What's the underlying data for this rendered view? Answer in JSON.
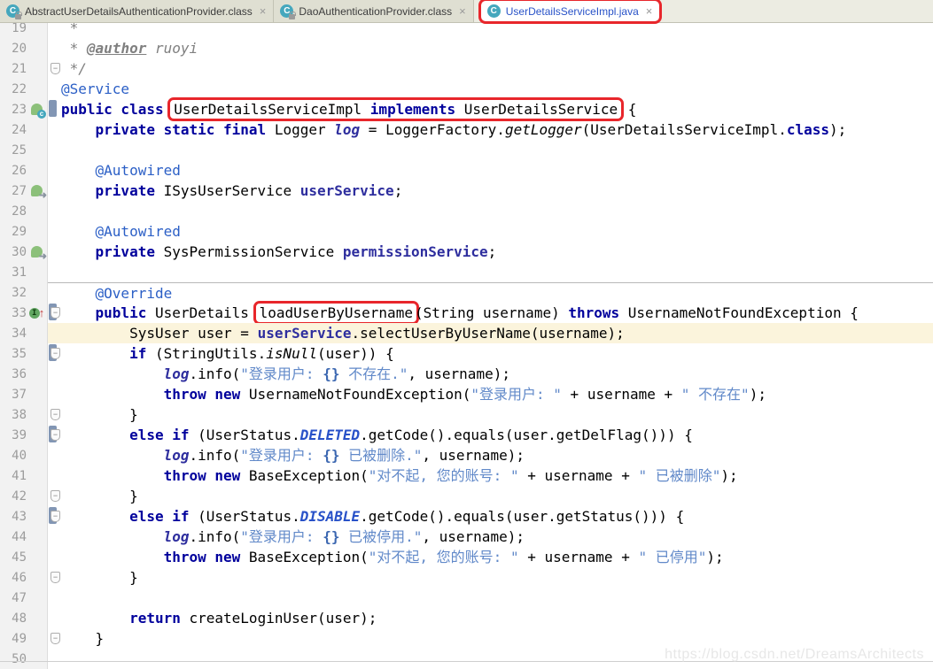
{
  "colors": {
    "annotation_red": "#E8262B",
    "active_tab_text": "#2953C8",
    "keyword_navy": "#00009C",
    "string_blue": "#6189C9",
    "caret_line_bg": "#FBF4DC",
    "gutter_bg": "#F2F2F2",
    "vcs_change_bar": "#8296B4"
  },
  "tabs": [
    {
      "label": "AbstractUserDetailsAuthenticationProvider.class",
      "icon": "class-file-icon",
      "active": false
    },
    {
      "label": "DaoAuthenticationProvider.class",
      "icon": "class-file-icon",
      "active": false
    },
    {
      "label": "UserDetailsServiceImpl.java",
      "icon": "java-class-icon",
      "active": true,
      "annotated": true
    }
  ],
  "watermark": "https://blog.csdn.net/DreamsArchitects",
  "editor": {
    "first_line": 19,
    "caret_line": 34,
    "lines": [
      {
        "n": 19,
        "tokens": [
          [
            "cmt",
            " *"
          ]
        ]
      },
      {
        "n": 20,
        "tokens": [
          [
            "cmt",
            " * "
          ],
          [
            "cmtTag",
            "@author"
          ],
          [
            "cmt",
            " ruoyi"
          ]
        ]
      },
      {
        "n": 21,
        "fold": true,
        "tokens": [
          [
            "cmt",
            " */"
          ]
        ]
      },
      {
        "n": 22,
        "tokens": [
          [
            "ann",
            "@Service"
          ]
        ]
      },
      {
        "n": 23,
        "icon": "spring-bean",
        "vcs": true,
        "tokens": [
          [
            "kw",
            "public class "
          ],
          [
            "box",
            [
              [
                "plain",
                "UserDetailsServiceImpl "
              ],
              [
                "kw",
                "implements"
              ],
              [
                "plain",
                " UserDetailsService"
              ]
            ]
          ],
          [
            "plain",
            " {"
          ]
        ]
      },
      {
        "n": 24,
        "tokens": [
          [
            "plain",
            "    "
          ],
          [
            "kw",
            "private static final "
          ],
          [
            "plain",
            "Logger "
          ],
          [
            "sfield",
            "log"
          ],
          [
            "plain",
            " = LoggerFactory."
          ],
          [
            "smeth",
            "getLogger"
          ],
          [
            "plain",
            "(UserDetailsServiceImpl."
          ],
          [
            "kw",
            "class"
          ],
          [
            "plain",
            ");"
          ]
        ]
      },
      {
        "n": 25,
        "tokens": []
      },
      {
        "n": 26,
        "tokens": [
          [
            "plain",
            "    "
          ],
          [
            "ann",
            "@Autowired"
          ]
        ]
      },
      {
        "n": 27,
        "icon": "spring-autowired",
        "tokens": [
          [
            "plain",
            "    "
          ],
          [
            "kw",
            "private "
          ],
          [
            "plain",
            "ISysUserService "
          ],
          [
            "field",
            "userService"
          ],
          [
            "plain",
            ";"
          ]
        ]
      },
      {
        "n": 28,
        "tokens": []
      },
      {
        "n": 29,
        "tokens": [
          [
            "plain",
            "    "
          ],
          [
            "ann",
            "@Autowired"
          ]
        ]
      },
      {
        "n": 30,
        "icon": "spring-autowired",
        "tokens": [
          [
            "plain",
            "    "
          ],
          [
            "kw",
            "private "
          ],
          [
            "plain",
            "SysPermissionService "
          ],
          [
            "field",
            "permissionService"
          ],
          [
            "plain",
            ";"
          ]
        ]
      },
      {
        "n": 31,
        "tokens": []
      },
      {
        "n": 32,
        "sep": true,
        "tokens": [
          [
            "plain",
            "    "
          ],
          [
            "ann",
            "@Override"
          ]
        ]
      },
      {
        "n": 33,
        "icon": "override-method",
        "vcs": true,
        "fold": true,
        "tokens": [
          [
            "plain",
            "    "
          ],
          [
            "kw",
            "public "
          ],
          [
            "plain",
            "UserDetails "
          ],
          [
            "box",
            [
              [
                "plain",
                "loadUserByUsername"
              ]
            ]
          ],
          [
            "plain",
            "(String username) "
          ],
          [
            "kw",
            "throws"
          ],
          [
            "plain",
            " UsernameNotFoundException {"
          ]
        ]
      },
      {
        "n": 34,
        "hl": true,
        "tokens": [
          [
            "plain",
            "        SysUser user = "
          ],
          [
            "field",
            "userService"
          ],
          [
            "plain",
            ".selectUserByUserName(username);"
          ]
        ]
      },
      {
        "n": 35,
        "vcs": true,
        "fold": true,
        "tokens": [
          [
            "plain",
            "        "
          ],
          [
            "kw",
            "if "
          ],
          [
            "plain",
            "(StringUtils."
          ],
          [
            "smeth",
            "isNull"
          ],
          [
            "plain",
            "(user)) {"
          ]
        ]
      },
      {
        "n": 36,
        "tokens": [
          [
            "plain",
            "            "
          ],
          [
            "sfield",
            "log"
          ],
          [
            "plain",
            ".info("
          ],
          [
            "str",
            "\"登录用户: "
          ],
          [
            "strTpl",
            "{}"
          ],
          [
            "str",
            " 不存在.\""
          ],
          [
            "plain",
            ", username);"
          ]
        ]
      },
      {
        "n": 37,
        "tokens": [
          [
            "plain",
            "            "
          ],
          [
            "kw",
            "throw new "
          ],
          [
            "plain",
            "UsernameNotFoundException("
          ],
          [
            "str",
            "\"登录用户: \""
          ],
          [
            "plain",
            " + username + "
          ],
          [
            "str",
            "\" 不存在\""
          ],
          [
            "plain",
            ");"
          ]
        ]
      },
      {
        "n": 38,
        "fold": true,
        "tokens": [
          [
            "plain",
            "        }"
          ]
        ]
      },
      {
        "n": 39,
        "vcs": true,
        "fold": true,
        "tokens": [
          [
            "plain",
            "        "
          ],
          [
            "kw",
            "else if "
          ],
          [
            "plain",
            "(UserStatus."
          ],
          [
            "const",
            "DELETED"
          ],
          [
            "plain",
            ".getCode().equals(user.getDelFlag())) {"
          ]
        ]
      },
      {
        "n": 40,
        "tokens": [
          [
            "plain",
            "            "
          ],
          [
            "sfield",
            "log"
          ],
          [
            "plain",
            ".info("
          ],
          [
            "str",
            "\"登录用户: "
          ],
          [
            "strTpl",
            "{}"
          ],
          [
            "str",
            " 已被删除.\""
          ],
          [
            "plain",
            ", username);"
          ]
        ]
      },
      {
        "n": 41,
        "tokens": [
          [
            "plain",
            "            "
          ],
          [
            "kw",
            "throw new "
          ],
          [
            "plain",
            "BaseException("
          ],
          [
            "str",
            "\"对不起, 您的账号: \""
          ],
          [
            "plain",
            " + username + "
          ],
          [
            "str",
            "\" 已被删除\""
          ],
          [
            "plain",
            ");"
          ]
        ]
      },
      {
        "n": 42,
        "fold": true,
        "tokens": [
          [
            "plain",
            "        }"
          ]
        ]
      },
      {
        "n": 43,
        "vcs": true,
        "fold": true,
        "tokens": [
          [
            "plain",
            "        "
          ],
          [
            "kw",
            "else if "
          ],
          [
            "plain",
            "(UserStatus."
          ],
          [
            "const",
            "DISABLE"
          ],
          [
            "plain",
            ".getCode().equals(user.getStatus())) {"
          ]
        ]
      },
      {
        "n": 44,
        "tokens": [
          [
            "plain",
            "            "
          ],
          [
            "sfield",
            "log"
          ],
          [
            "plain",
            ".info("
          ],
          [
            "str",
            "\"登录用户: "
          ],
          [
            "strTpl",
            "{}"
          ],
          [
            "str",
            " 已被停用.\""
          ],
          [
            "plain",
            ", username);"
          ]
        ]
      },
      {
        "n": 45,
        "tokens": [
          [
            "plain",
            "            "
          ],
          [
            "kw",
            "throw new "
          ],
          [
            "plain",
            "BaseException("
          ],
          [
            "str",
            "\"对不起, 您的账号: \""
          ],
          [
            "plain",
            " + username + "
          ],
          [
            "str",
            "\" 已停用\""
          ],
          [
            "plain",
            ");"
          ]
        ]
      },
      {
        "n": 46,
        "fold": true,
        "tokens": [
          [
            "plain",
            "        }"
          ]
        ]
      },
      {
        "n": 47,
        "tokens": []
      },
      {
        "n": 48,
        "tokens": [
          [
            "plain",
            "        "
          ],
          [
            "kw",
            "return "
          ],
          [
            "plain",
            "createLoginUser(user);"
          ]
        ]
      },
      {
        "n": 49,
        "fold": true,
        "tokens": [
          [
            "plain",
            "    }"
          ]
        ]
      },
      {
        "n": 50,
        "tokens": []
      }
    ]
  }
}
